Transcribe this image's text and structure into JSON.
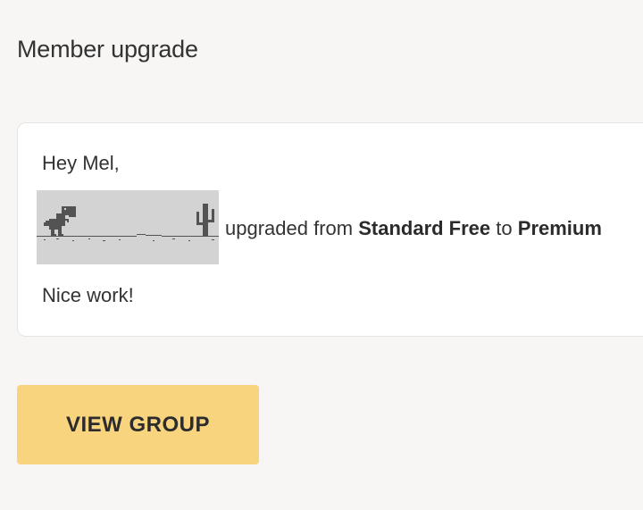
{
  "header": {
    "title": "Member upgrade"
  },
  "card": {
    "greeting": "Hey Mel,",
    "image_icon": "dino-offline-icon",
    "message_prefix": "upgraded from",
    "from_plan": "Standard Free",
    "message_middle": "to",
    "to_plan": "Premium",
    "closing": "Nice work!"
  },
  "actions": {
    "view_group_label": "VIEW GROUP"
  },
  "colors": {
    "background": "#f7f6f4",
    "card_background": "#ffffff",
    "button_background": "#f8d47f",
    "image_background": "#d3d3d3",
    "dino_color": "#535353"
  }
}
